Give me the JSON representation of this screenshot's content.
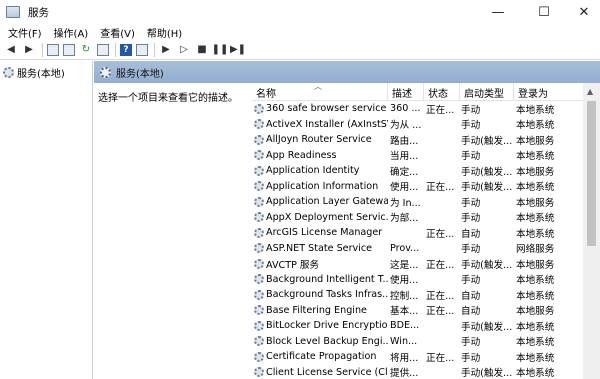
{
  "window": {
    "title": "服务"
  },
  "menu": [
    "文件(F)",
    "操作(A)",
    "查看(V)",
    "帮助(H)"
  ],
  "tree": {
    "root_label": "服务(本地)"
  },
  "panel": {
    "title": "服务(本地)",
    "description_hint": "选择一个项目来查看它的描述。"
  },
  "columns": {
    "name": "名称",
    "desc": "描述",
    "status": "状态",
    "startup": "启动类型",
    "logon": "登录为"
  },
  "services": [
    {
      "name": "360 safe browser service",
      "desc": "360 ...",
      "status": "正在...",
      "startup": "手动",
      "logon": "本地系统"
    },
    {
      "name": "ActiveX Installer (AxInstSV)",
      "desc": "为从 ...",
      "status": "",
      "startup": "手动",
      "logon": "本地系统"
    },
    {
      "name": "AllJoyn Router Service",
      "desc": "路由...",
      "status": "",
      "startup": "手动(触发...",
      "logon": "本地服务"
    },
    {
      "name": "App Readiness",
      "desc": "当用...",
      "status": "",
      "startup": "手动",
      "logon": "本地系统"
    },
    {
      "name": "Application Identity",
      "desc": "确定...",
      "status": "",
      "startup": "手动(触发...",
      "logon": "本地服务"
    },
    {
      "name": "Application Information",
      "desc": "使用...",
      "status": "正在...",
      "startup": "手动(触发...",
      "logon": "本地系统"
    },
    {
      "name": "Application Layer Gatewa...",
      "desc": "为 In...",
      "status": "",
      "startup": "手动",
      "logon": "本地服务"
    },
    {
      "name": "AppX Deployment Servic...",
      "desc": "为部...",
      "status": "",
      "startup": "手动",
      "logon": "本地系统"
    },
    {
      "name": "ArcGIS License Manager",
      "desc": "",
      "status": "正在...",
      "startup": "自动",
      "logon": "本地系统"
    },
    {
      "name": "ASP.NET State Service",
      "desc": "Prov...",
      "status": "",
      "startup": "手动",
      "logon": "网络服务"
    },
    {
      "name": "AVCTP 服务",
      "desc": "这是...",
      "status": "正在...",
      "startup": "手动(触发...",
      "logon": "本地服务"
    },
    {
      "name": "Background Intelligent T...",
      "desc": "使用...",
      "status": "",
      "startup": "手动",
      "logon": "本地系统"
    },
    {
      "name": "Background Tasks Infras...",
      "desc": "控制...",
      "status": "正在...",
      "startup": "自动",
      "logon": "本地系统"
    },
    {
      "name": "Base Filtering Engine",
      "desc": "基本...",
      "status": "正在...",
      "startup": "自动",
      "logon": "本地服务"
    },
    {
      "name": "BitLocker Drive Encryptio...",
      "desc": "BDE...",
      "status": "",
      "startup": "手动(触发...",
      "logon": "本地系统"
    },
    {
      "name": "Block Level Backup Engi...",
      "desc": "Win...",
      "status": "",
      "startup": "手动",
      "logon": "本地系统"
    },
    {
      "name": "Certificate Propagation",
      "desc": "将用...",
      "status": "正在...",
      "startup": "手动",
      "logon": "本地系统"
    },
    {
      "name": "Client License Service (Cli...",
      "desc": "提供...",
      "status": "",
      "startup": "手动(触发...",
      "logon": "本地系统"
    }
  ]
}
